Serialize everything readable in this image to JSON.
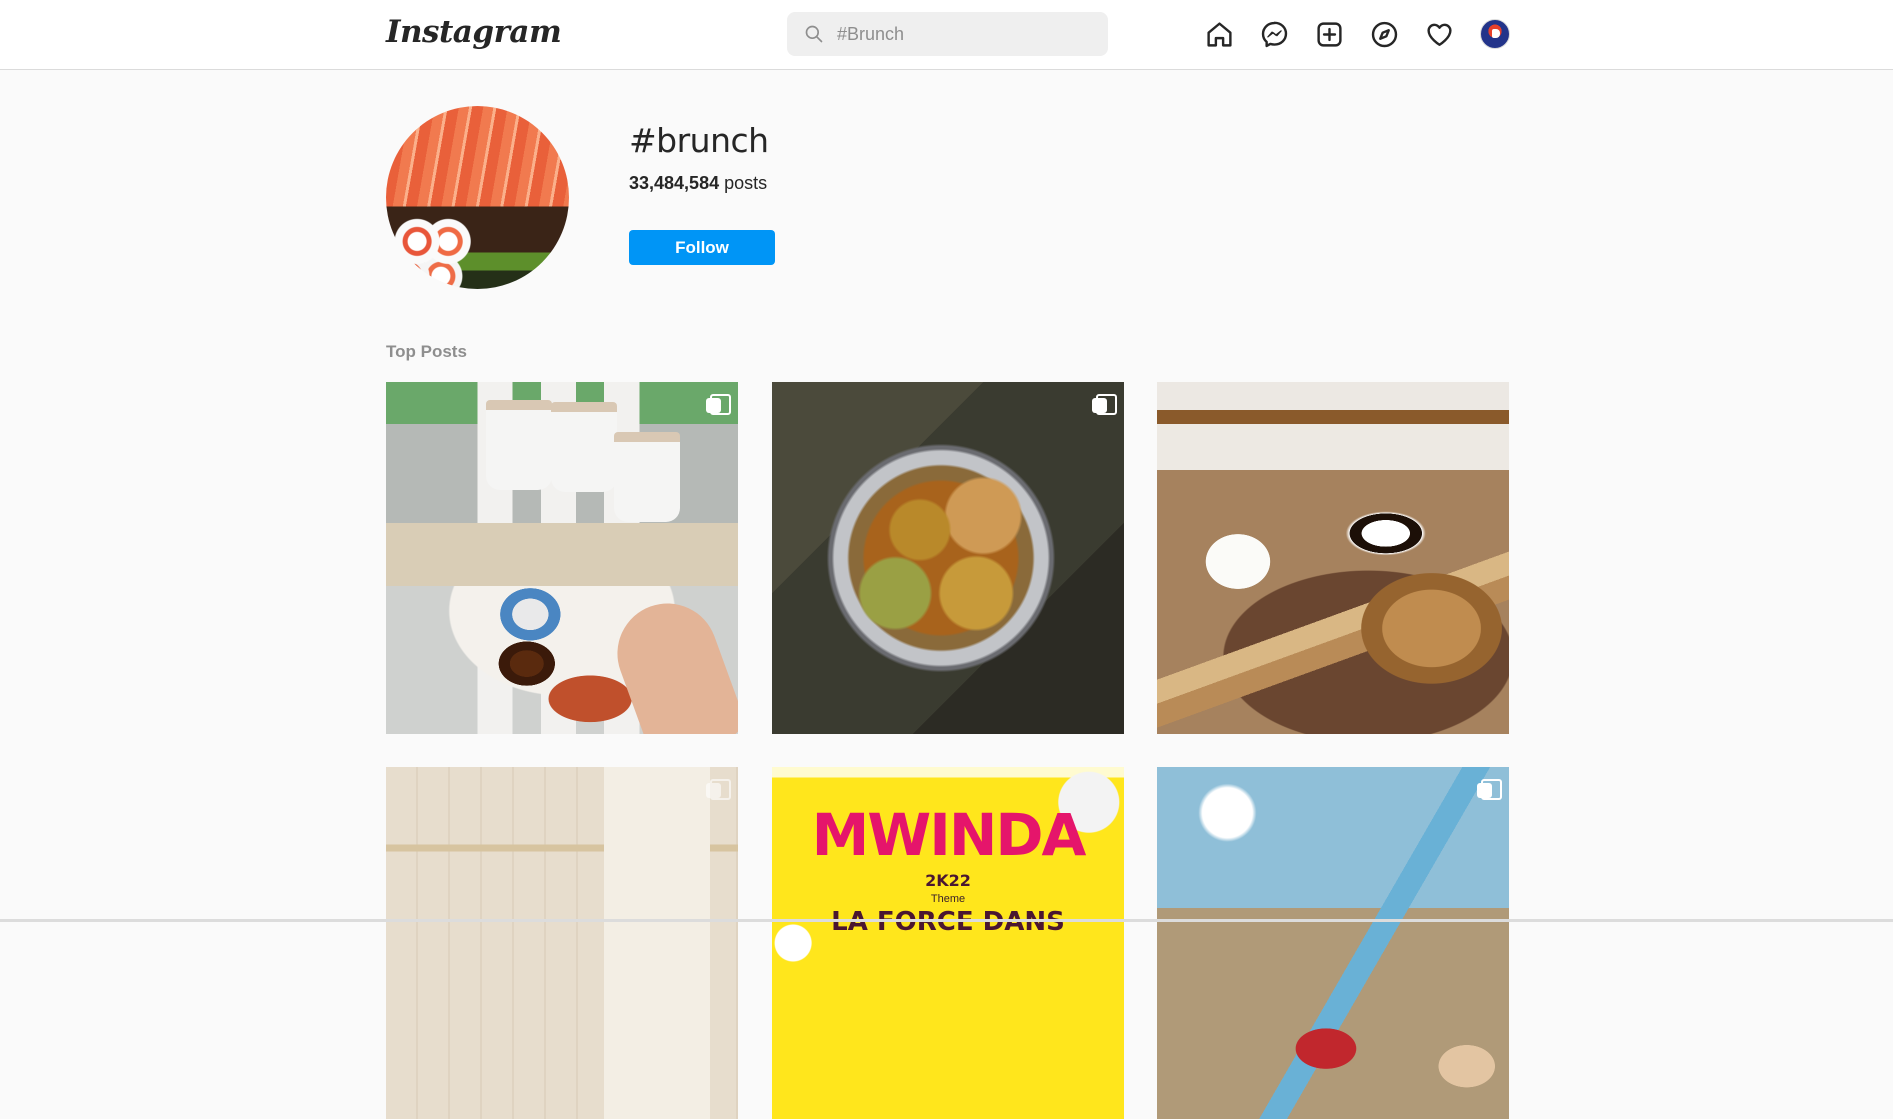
{
  "app": {
    "logo": "Instagram"
  },
  "search": {
    "placeholder": "#Brunch"
  },
  "nav": {
    "icons": [
      "home-icon",
      "messenger-icon",
      "new-post-icon",
      "explore-icon",
      "activity-heart-icon",
      "profile-avatar"
    ]
  },
  "hashtag": {
    "title": "#brunch",
    "post_count": "33,484,584",
    "posts_word": " posts",
    "follow_label": "Follow"
  },
  "section": {
    "top_posts": "Top Posts"
  },
  "posts": [
    {
      "kind": "carousel"
    },
    {
      "kind": "carousel"
    },
    {
      "kind": "single"
    },
    {
      "kind": "carousel"
    },
    {
      "kind": "single"
    },
    {
      "kind": "carousel"
    }
  ],
  "poster": {
    "title": "MWINDA",
    "year": "2K22",
    "theme_label": "Theme",
    "bottom_text": "LA FORCE DANS"
  },
  "colors": {
    "accent": "#0095f6",
    "text": "#262626",
    "muted": "#8e8e8e",
    "background": "#fafafa"
  }
}
